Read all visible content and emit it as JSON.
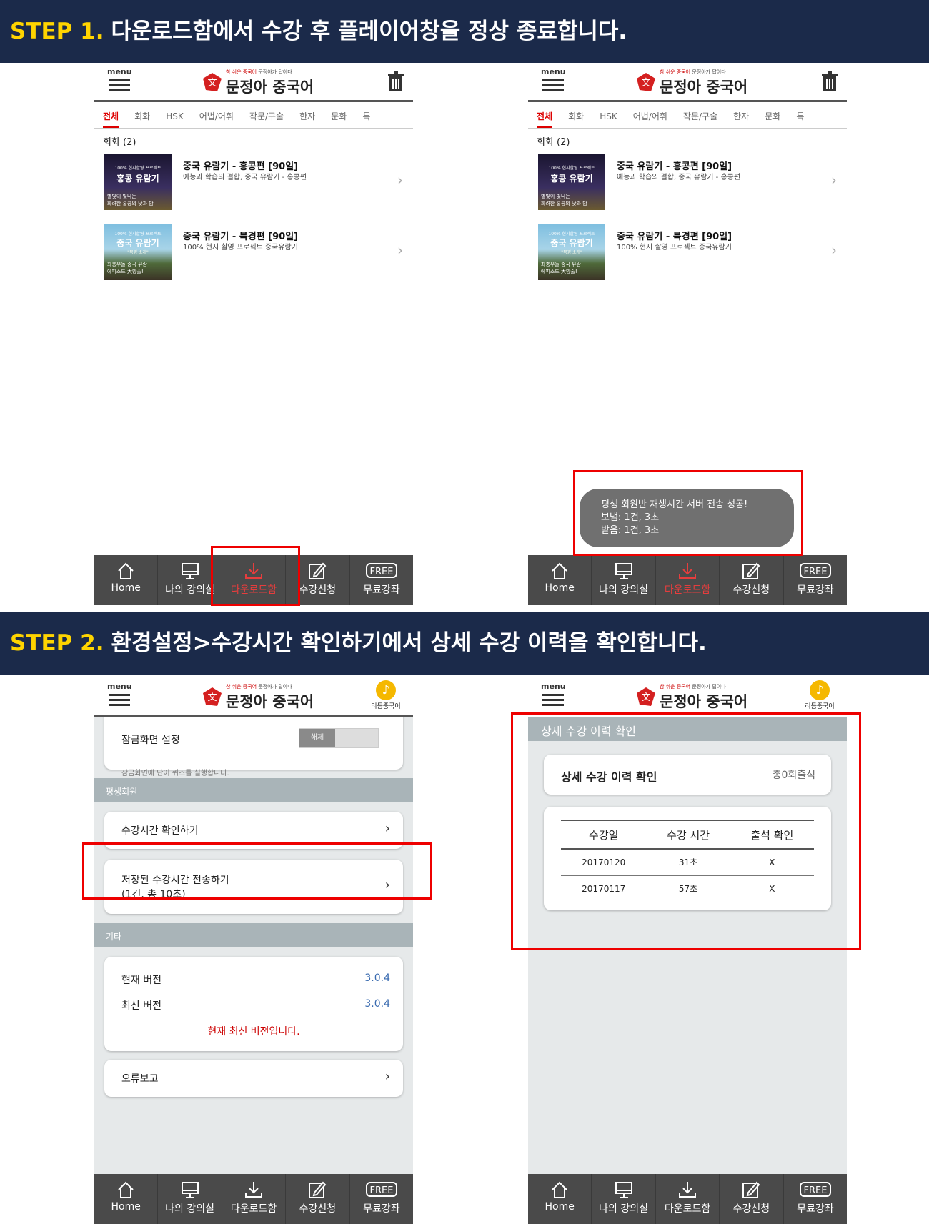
{
  "step1": {
    "label": "STEP 1.",
    "text": "다운로드함에서 수강 후 플레이어창을 정상 종료합니다."
  },
  "step2": {
    "label": "STEP 2.",
    "text": "환경설정>수강시간 확인하기에서 상세 수강 이력을 확인합니다."
  },
  "app": {
    "menu_label": "menu",
    "logo_tag_red": "참 쉬운 중국어",
    "logo_tag": "문정아가 답이다",
    "logo_since": "Since 2003",
    "logo_name": "문정아 중국어",
    "rhythm_label": "리듬중국어",
    "rhythm_glyph": "♪"
  },
  "tabs": [
    "전체",
    "회화",
    "HSK",
    "어법/어휘",
    "작문/구술",
    "한자",
    "문화",
    "특"
  ],
  "section_label": "회화 (2)",
  "courses": [
    {
      "title": "중국 유람기 - 홍콩편 [90일]",
      "desc": "예능과 학습의 결합, 중국 유람기 - 홍콩편",
      "thumb_top": "100% 현지촬영 프로젝트",
      "thumb_title": "홍콩 유람기",
      "thumb_line1": "별빛이 빛나는",
      "thumb_line2": "화려한 홍콩의 낮과 밤"
    },
    {
      "title": "중국 유람기 - 북경편 [90일]",
      "desc": "100% 현지 촬영 프로젝트 중국유람기",
      "thumb_top": "100% 현지촬영 프로젝트",
      "thumb_title": "중국 유람기",
      "thumb_sub": "\"북경 소개\"",
      "thumb_line1": "좌충우돌 중국 유람",
      "thumb_line2": "에피소드 大방출!"
    }
  ],
  "nav": [
    {
      "label": "Home",
      "icon": "home-icon"
    },
    {
      "label": "나의 강의실",
      "icon": "monitor-icon"
    },
    {
      "label": "다운로드함",
      "icon": "download-icon"
    },
    {
      "label": "수강신청",
      "icon": "edit-icon"
    },
    {
      "label": "무료강좌",
      "icon": "free-icon",
      "badge": "FREE"
    }
  ],
  "toast": {
    "line1": "평생 회원반 재생시간 서버 전송 성공!",
    "line2": "보냄: 1건, 3초",
    "line3": "받음: 1건, 3초"
  },
  "settings": {
    "lock_title": "잠금화면 설정",
    "lock_toggle": "해제",
    "lock_desc": "잠금화면에 단어 퀴즈를 실행합니다.",
    "lifetime_header": "평생회원",
    "check_time": "수강시간 확인하기",
    "send_saved_1": "저장된 수강시간 전송하기",
    "send_saved_2": "(1건, 총 10초)",
    "etc_header": "기타",
    "current_version_label": "현재 버전",
    "current_version": "3.0.4",
    "latest_version_label": "최신 버전",
    "latest_version": "3.0.4",
    "latest_msg": "현재 최신 버전입니다.",
    "error_report": "오류보고",
    "chevron": "›"
  },
  "detail": {
    "title": "상세 수강 이력 확인",
    "card_title": "상세 수강 이력 확인",
    "attendance": "총0회출석",
    "headers": [
      "수강일",
      "수강 시간",
      "출석 확인"
    ],
    "rows": [
      [
        "20170120",
        "31초",
        "X"
      ],
      [
        "20170117",
        "57초",
        "X"
      ]
    ]
  },
  "colors": {
    "banner_bg": "#1b2a4a",
    "step_label": "#ffd400",
    "highlight": "#e00000",
    "nav_bg": "#4a4a4a",
    "active_tab": "#d00000"
  }
}
